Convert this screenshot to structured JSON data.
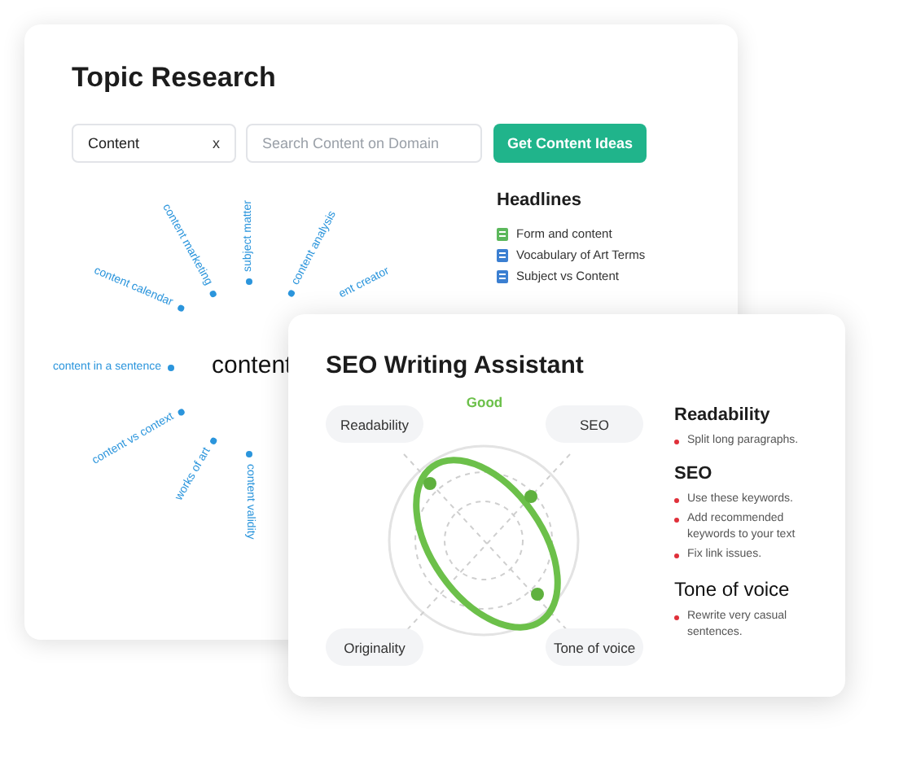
{
  "topic_research": {
    "title": "Topic Research",
    "topic_field": {
      "value": "Content",
      "clear": "x"
    },
    "domain_field": {
      "placeholder": "Search Content on Domain"
    },
    "button": "Get Content Ideas",
    "mind_map": {
      "center": "content",
      "keywords": [
        {
          "text": "content marketing",
          "kind": "end"
        },
        {
          "text": "subject matter",
          "kind": "start"
        },
        {
          "text": "content analysis",
          "kind": "start"
        },
        {
          "text": "ent creator",
          "kind": "cut"
        },
        {
          "text": "content calendar",
          "kind": "end"
        },
        {
          "text": "content in a sentence",
          "kind": "end"
        },
        {
          "text": "content vs context",
          "kind": "end"
        },
        {
          "text": "works of art",
          "kind": "end"
        },
        {
          "text": "content validity",
          "kind": "start"
        }
      ]
    },
    "headlines": {
      "title": "Headlines",
      "items": [
        {
          "text": "Form and content",
          "color": "#5cb85c"
        },
        {
          "text": "Vocabulary of Art Terms",
          "color": "#3b7fd1"
        },
        {
          "text": "Subject vs Content",
          "color": "#3b7fd1"
        }
      ]
    }
  },
  "seo_writing_assistant": {
    "title": "SEO Writing Assistant",
    "rating": "Good",
    "axes": [
      "Readability",
      "SEO",
      "Originality",
      "Tone of voice"
    ],
    "sections": [
      {
        "title": "Readability",
        "tips": [
          "Split long paragraphs."
        ]
      },
      {
        "title": "SEO",
        "tips": [
          "Use these keywords.",
          "Add recommended keywords to your text",
          "Fix link issues."
        ]
      },
      {
        "title": "Tone of voice",
        "tips": [
          "Rewrite very casual sentences."
        ]
      }
    ]
  }
}
